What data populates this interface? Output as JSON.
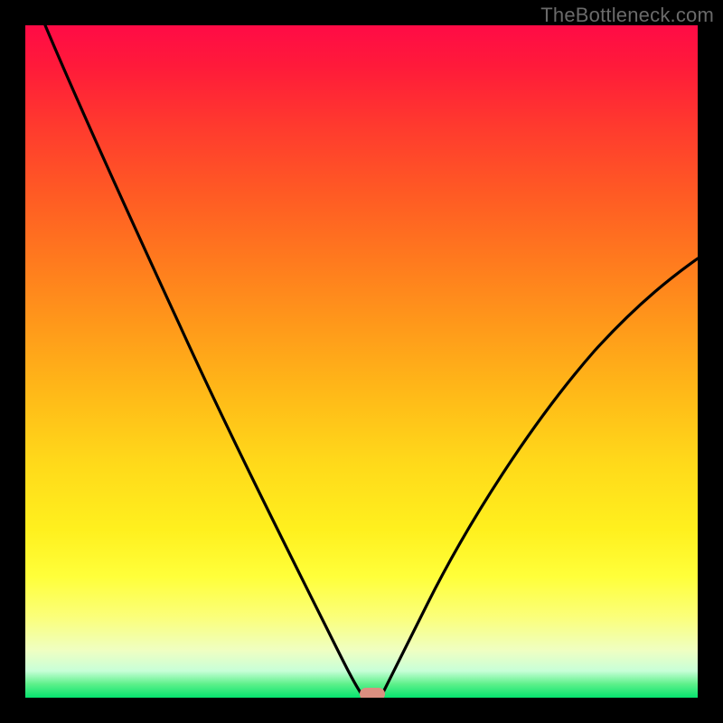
{
  "watermark": "TheBottleneck.com",
  "chart_data": {
    "type": "line",
    "title": "",
    "xlabel": "",
    "ylabel": "",
    "xlim": [
      0,
      100
    ],
    "ylim": [
      0,
      100
    ],
    "grid": false,
    "legend": false,
    "x": [
      3,
      10,
      18,
      26,
      34,
      40,
      45,
      48,
      50,
      51,
      52,
      54,
      57,
      62,
      70,
      80,
      90,
      100
    ],
    "y": [
      100,
      85,
      70,
      54,
      38,
      24,
      12,
      4,
      0,
      0,
      0,
      2,
      8,
      18,
      32,
      46,
      57,
      65
    ],
    "min_marker": {
      "x": 51,
      "y": 0
    },
    "gradient_stops": [
      {
        "pos": 0,
        "color": "#ff0b46"
      },
      {
        "pos": 50,
        "color": "#ffba18"
      },
      {
        "pos": 82,
        "color": "#ffff3a"
      },
      {
        "pos": 100,
        "color": "#06e36e"
      }
    ]
  }
}
